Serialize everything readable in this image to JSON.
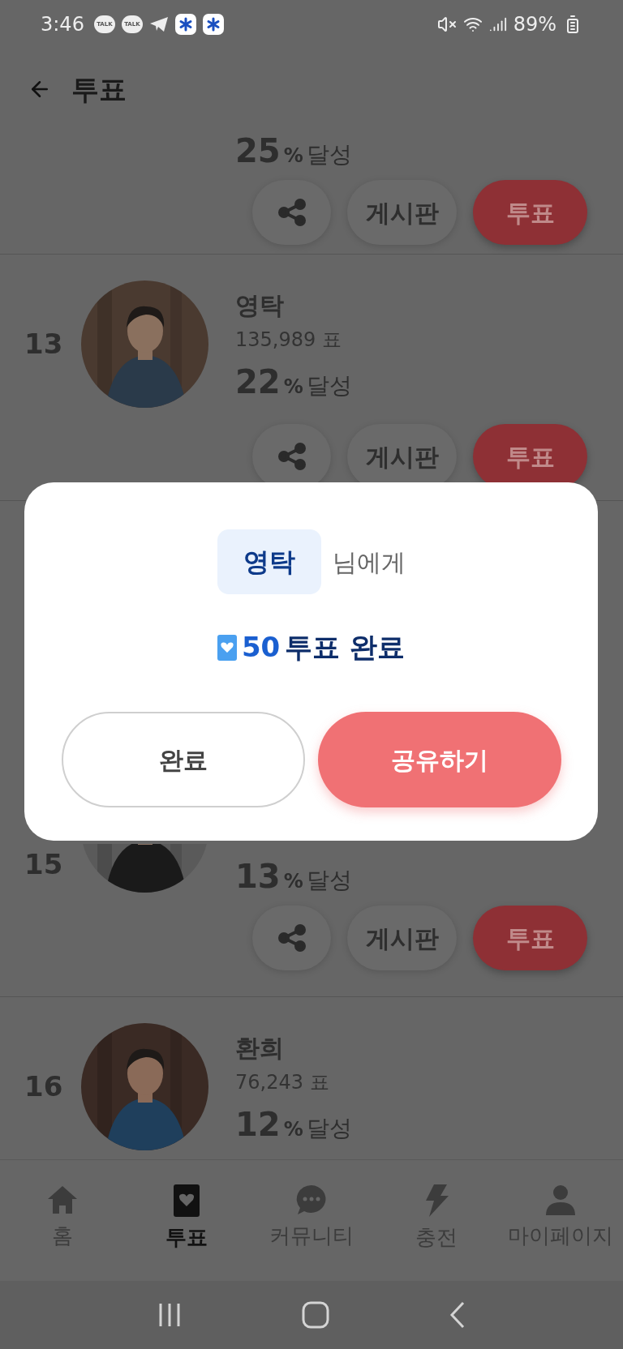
{
  "status_bar": {
    "time": "3:46",
    "notifications": [
      {
        "kind": "talk",
        "label": "TALK"
      },
      {
        "kind": "talk",
        "label": "TALK"
      },
      {
        "kind": "telegram"
      },
      {
        "kind": "asterisk"
      },
      {
        "kind": "asterisk"
      }
    ],
    "battery": "89%"
  },
  "header": {
    "title": "투표"
  },
  "rows": [
    {
      "kind": "partial_top",
      "percent": "25",
      "unit": "%",
      "label": "달성",
      "board": "게시판",
      "vote": "투표"
    },
    {
      "kind": "full",
      "rank": "13",
      "name": "영탁",
      "votes": "135,989 표",
      "percent": "22",
      "unit": "%",
      "label": "달성",
      "board": "게시판",
      "vote": "투표"
    },
    {
      "kind": "covered",
      "rank": "15",
      "percent": "13",
      "unit": "%",
      "label": "달성",
      "board": "게시판",
      "vote": "투표"
    },
    {
      "kind": "cut_bottom",
      "rank": "16",
      "name": "환희",
      "votes": "76,243 표",
      "percent": "12",
      "unit": "%",
      "label": "달성"
    }
  ],
  "dialog": {
    "name": "영탁",
    "suffix": "님에게",
    "count": "50",
    "message": "투표 완료",
    "buttons": [
      {
        "label": "완료",
        "kind": "outline"
      },
      {
        "label": "공유하기",
        "kind": "primary"
      }
    ]
  },
  "nav": [
    {
      "label": "홈",
      "kind": "home",
      "selected": false
    },
    {
      "label": "투표",
      "kind": "vote",
      "selected": true
    },
    {
      "label": "커뮤니티",
      "kind": "chat",
      "selected": false
    },
    {
      "label": "충전",
      "kind": "bolt",
      "selected": false
    },
    {
      "label": "마이페이지",
      "kind": "person",
      "selected": false
    }
  ]
}
